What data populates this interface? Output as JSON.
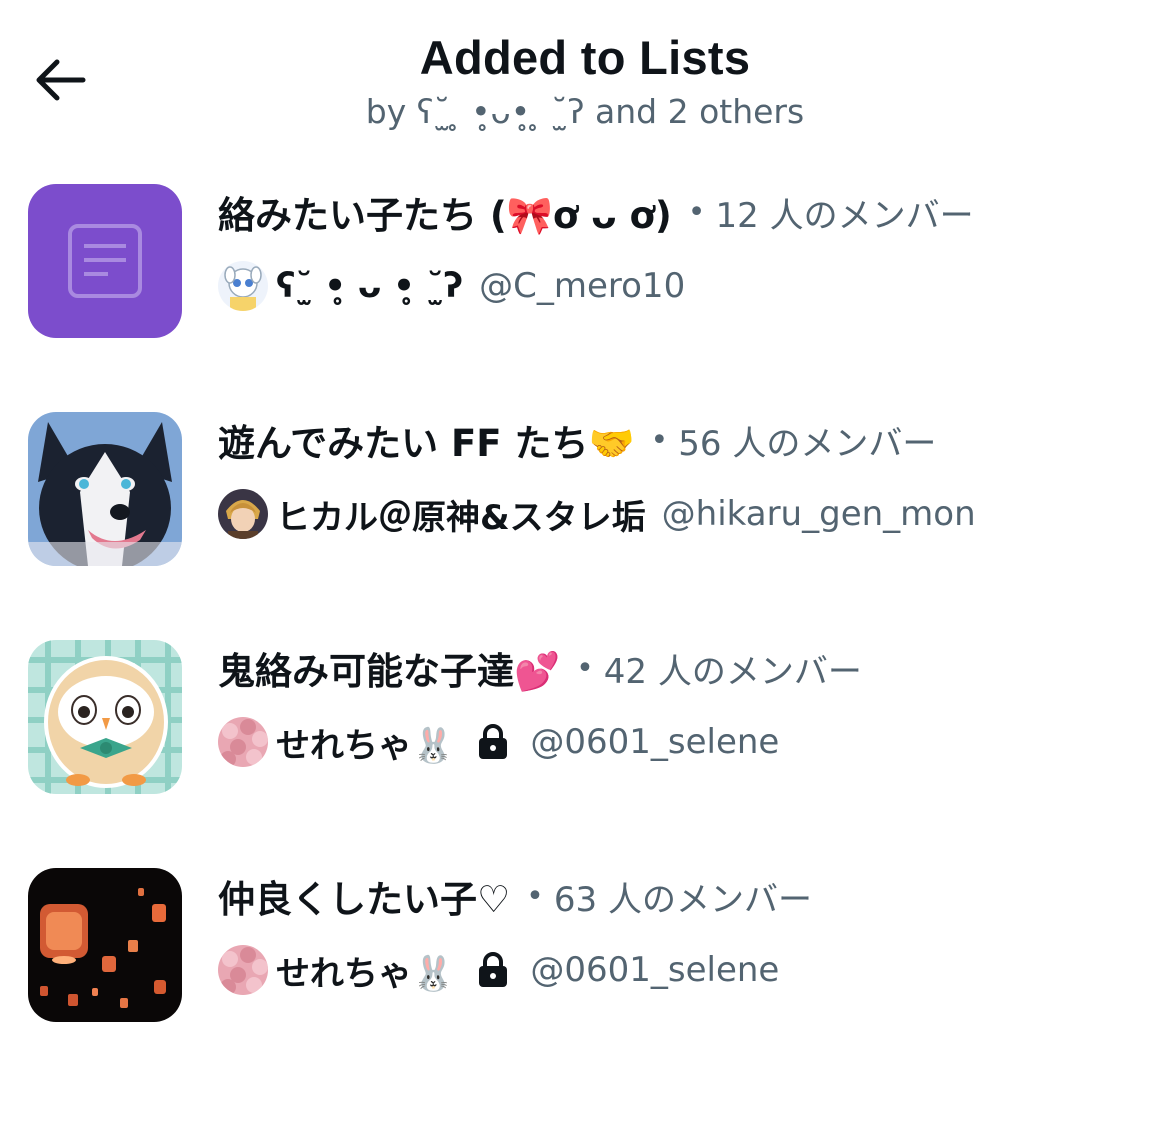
{
  "header": {
    "title": "Added to Lists",
    "subtitle": "by ʕ˘̫ ̥ •̥ᴗ•̥ ̥ ˘̫ʔ and 2 others"
  },
  "lists": [
    {
      "name": "絡みたい子たち (🎀ơ ᴗ ơ)",
      "members": "12 人のメンバー",
      "owner_name": "ʕ˘̫ •̥ ᴗ •̥ ˘̫ʔ",
      "owner_handle": "@C_mero10",
      "protected": false,
      "thumb_icon": "list-icon",
      "thumb_color": "#7c4dcc"
    },
    {
      "name": "遊んでみたい FF たち🤝",
      "members": "56 人のメンバー",
      "owner_name": "ヒカル＠原神&スタレ垢",
      "owner_handle": "@hikaru_gen_mon",
      "protected": false,
      "thumb_icon": "husky-image"
    },
    {
      "name": "鬼絡み可能な子達💕",
      "members": "42 人のメンバー",
      "owner_name": "せれちゃ🐰",
      "owner_handle": "@0601_selene",
      "protected": true,
      "thumb_icon": "owl-image"
    },
    {
      "name": "仲良くしたい子♡",
      "members": "63 人のメンバー",
      "owner_name": "せれちゃ🐰",
      "owner_handle": "@0601_selene",
      "protected": true,
      "thumb_icon": "lanterns-image"
    }
  ],
  "icons": {
    "back": "back-arrow-icon",
    "lock": "lock-icon"
  },
  "colors": {
    "secondary_text": "#536471",
    "primary_text": "#0f1419",
    "list_purple": "#7c4dcc"
  }
}
